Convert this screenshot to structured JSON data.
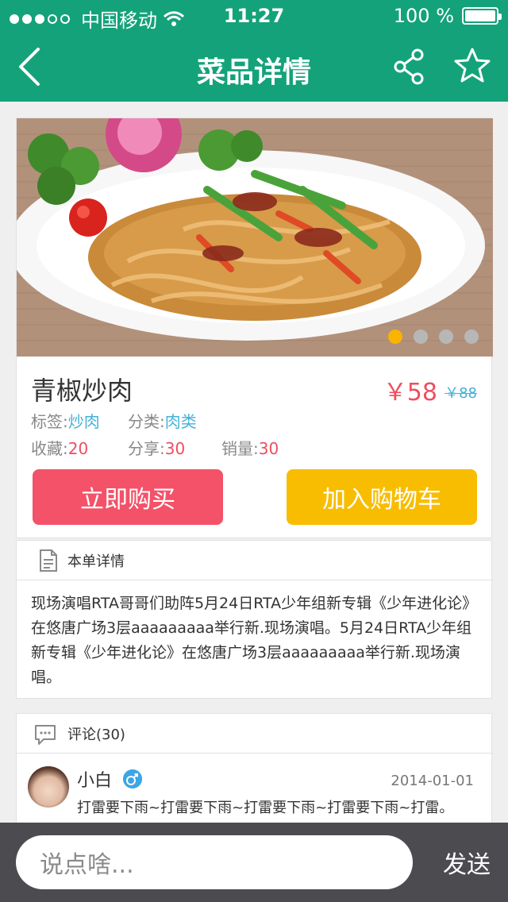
{
  "status_bar": {
    "carrier": "中国移动",
    "time": "11:27",
    "battery": "100 %"
  },
  "nav": {
    "title": "菜品详情"
  },
  "product": {
    "name": "青椒炒肉",
    "price": "￥58",
    "old_price": "￥88",
    "tags_label": "标签:",
    "tags_value": "炒肉",
    "category_label": "分类:",
    "category_value": "肉类",
    "favorites_label": "收藏:",
    "favorites_value": "20",
    "shares_label": "分享:",
    "shares_value": "30",
    "sales_label": "销量:",
    "sales_value": "30",
    "buy_now": "立即购买",
    "add_to_cart": "加入购物车",
    "carousel": {
      "count": 4,
      "active_index": 0
    }
  },
  "detail": {
    "title": "本单详情",
    "text": "现场演唱RTA哥哥们助阵5月24日RTA少年组新专辑《少年进化论》在悠唐广场3层aaaaaaaaa举行新.现场演唱。5月24日RTA少年组新专辑《少年进化论》在悠唐广场3层aaaaaaaaa举行新.现场演唱。"
  },
  "comments": {
    "title": "评论(30)",
    "items": [
      {
        "user": "小白",
        "date": "2014-01-01",
        "text": "打雷要下雨~打雷要下雨~打雷要下雨~打雷要下雨~打雷。"
      }
    ]
  },
  "bottom": {
    "input_placeholder": "说点啥...",
    "send": "发送"
  },
  "colors": {
    "header_green": "#14a27a",
    "price_red": "#ee4e5f",
    "link_blue": "#43b2d8",
    "buy_button": "#f35268",
    "cart_button": "#f8bd00",
    "active_dot": "#f8b400",
    "bottom_bar": "#4b4b50"
  },
  "icons": [
    "back-icon",
    "share-icon",
    "star-icon",
    "document-icon",
    "comment-icon",
    "male-icon",
    "wifi-icon",
    "battery-icon",
    "signal-icon"
  ]
}
